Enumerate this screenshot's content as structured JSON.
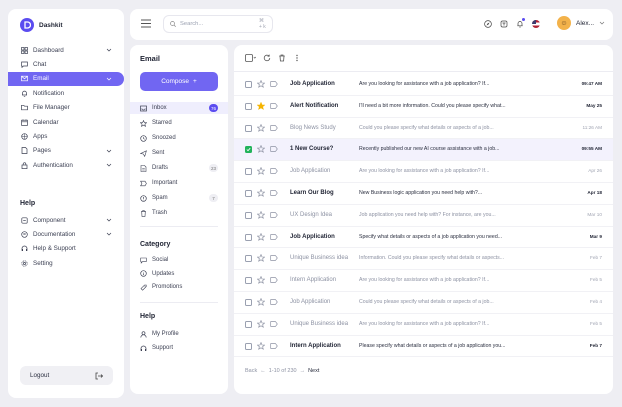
{
  "brand": {
    "name": "Dashkit",
    "accent": "#7166f2"
  },
  "sidebar": {
    "items": [
      {
        "label": "Dashboard",
        "icon": "dashboard-icon",
        "chevron": true
      },
      {
        "label": "Chat",
        "icon": "chat-icon",
        "chevron": false
      },
      {
        "label": "Email",
        "icon": "email-icon",
        "chevron": true,
        "active": true
      },
      {
        "label": "Notification",
        "icon": "bell-icon",
        "chevron": false
      },
      {
        "label": "File Manager",
        "icon": "folder-icon",
        "chevron": false
      },
      {
        "label": "Calendar",
        "icon": "calendar-icon",
        "chevron": false
      },
      {
        "label": "Apps",
        "icon": "apps-icon",
        "chevron": false
      },
      {
        "label": "Pages",
        "icon": "pages-icon",
        "chevron": true
      },
      {
        "label": "Authentication",
        "icon": "lock-icon",
        "chevron": true
      }
    ],
    "help_title": "Help",
    "help_items": [
      {
        "label": "Component",
        "icon": "component-icon",
        "chevron": true
      },
      {
        "label": "Documentation",
        "icon": "document-icon",
        "chevron": true
      },
      {
        "label": "Help & Support",
        "icon": "headset-icon",
        "chevron": false
      },
      {
        "label": "Setting",
        "icon": "gear-icon",
        "chevron": false
      }
    ],
    "logout_label": "Logout"
  },
  "topbar": {
    "search_placeholder": "Search...",
    "shortcut": "⌘ + k",
    "user_name": "Alex..."
  },
  "folders": {
    "title": "Email",
    "compose_label": "Compose",
    "items": [
      {
        "label": "Inbox",
        "icon": "inbox-icon",
        "badge": "76",
        "active": true
      },
      {
        "label": "Starred",
        "icon": "star-icon",
        "badge": ""
      },
      {
        "label": "Snoozed",
        "icon": "clock-icon",
        "badge": ""
      },
      {
        "label": "Sent",
        "icon": "send-icon",
        "badge": ""
      },
      {
        "label": "Drafts",
        "icon": "draft-icon",
        "badge": "23"
      },
      {
        "label": "Important",
        "icon": "important-icon",
        "badge": ""
      },
      {
        "label": "Spam",
        "icon": "spam-icon",
        "badge": "7"
      },
      {
        "label": "Trash",
        "icon": "trash-icon",
        "badge": ""
      }
    ],
    "category_title": "Category",
    "categories": [
      {
        "label": "Social",
        "icon": "social-icon"
      },
      {
        "label": "Updates",
        "icon": "updates-icon"
      },
      {
        "label": "Promotions",
        "icon": "promotions-icon"
      }
    ],
    "help_title": "Help",
    "help_items": [
      {
        "label": "My Profile",
        "icon": "profile-icon"
      },
      {
        "label": "Support",
        "icon": "support-icon"
      }
    ]
  },
  "mail": {
    "rows": [
      {
        "sender": "Job Application",
        "subject": "Are you looking for assistance with a job application? If...",
        "date": "09:47 AM",
        "unread": true,
        "starred": false,
        "checked": false
      },
      {
        "sender": "Alert Notification",
        "subject": "I'll need a bit more information. Could you please specify what...",
        "date": "May 25",
        "unread": true,
        "starred": true,
        "checked": false
      },
      {
        "sender": "Blog News Study",
        "subject": "Could you please specify what details or aspects of a job...",
        "date": "11:26 AM",
        "unread": false,
        "starred": false,
        "checked": false
      },
      {
        "sender": "1 New Course?",
        "subject": "Recently published our new AI course assistance with a job...",
        "date": "09:55 AM",
        "unread": true,
        "starred": false,
        "checked": true
      },
      {
        "sender": "Job Application",
        "subject": "Are you looking for assistance with a job application? If...",
        "date": "Apr 26",
        "unread": false,
        "starred": false,
        "checked": false
      },
      {
        "sender": "Learn Our Blog",
        "subject": "New Business logic application you need help with?...",
        "date": "Apr 18",
        "unread": true,
        "starred": false,
        "checked": false
      },
      {
        "sender": "UX Design Idea",
        "subject": "Job application you need help with? For instance, are you...",
        "date": "Mar 10",
        "unread": false,
        "starred": false,
        "checked": false
      },
      {
        "sender": "Job Application",
        "subject": "Specify what details or aspects of a job application you need...",
        "date": "Mar 9",
        "unread": true,
        "starred": false,
        "checked": false
      },
      {
        "sender": "Unique Business idea",
        "subject": "Information. Could you please specify what details or aspects...",
        "date": "Feb 7",
        "unread": false,
        "starred": false,
        "checked": false
      },
      {
        "sender": "Intern Application",
        "subject": "Are you looking for assistance with a job application? If...",
        "date": "Feb 5",
        "unread": false,
        "starred": false,
        "checked": false
      },
      {
        "sender": "Job Application",
        "subject": "Could you please specify what details or aspects of a job...",
        "date": "Feb 4",
        "unread": false,
        "starred": false,
        "checked": false
      },
      {
        "sender": "Unique Business idea",
        "subject": "Are you looking for assistance with a job application? If...",
        "date": "Feb 5",
        "unread": false,
        "starred": false,
        "checked": false
      },
      {
        "sender": "Intern Application",
        "subject": "Please specify what details or aspects of a job application you...",
        "date": "Feb 7",
        "unread": true,
        "starred": false,
        "checked": false
      }
    ],
    "pager": {
      "back": "Back",
      "range": "1-10 of 230",
      "next": "Next"
    }
  }
}
